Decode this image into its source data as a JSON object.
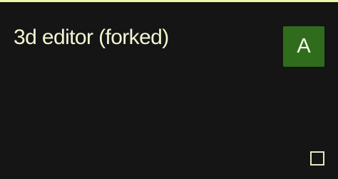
{
  "window": {
    "title": "3d editor (forked)"
  },
  "user": {
    "avatar_initial": "A"
  },
  "controls": {
    "corner_button_icon": "square-outline-icon"
  },
  "colors": {
    "background": "#151515",
    "accent": "#f0f7a6",
    "title": "#f3f5d3",
    "avatar_background": "#2f6d1c",
    "avatar_text": "#f5f7ef",
    "corner_button_outline": "#e7ebc4"
  }
}
